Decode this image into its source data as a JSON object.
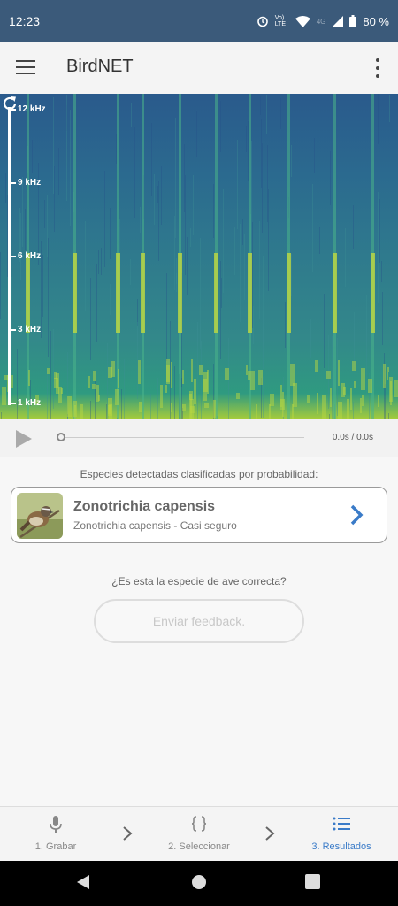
{
  "status_bar": {
    "time": "12:23",
    "network": "4G",
    "volte": "Vo) LTE",
    "battery": "80 %"
  },
  "app": {
    "title": "BirdNET"
  },
  "spectrogram": {
    "frequency_labels": [
      "12 kHz",
      "9 kHz",
      "6 kHz",
      "3 kHz",
      "1 kHz"
    ]
  },
  "player": {
    "time": "0.0s / 0.0s"
  },
  "results": {
    "heading": "Especies detectadas clasificadas por probabilidad:",
    "species": [
      {
        "name": "Zonotrichia capensis",
        "detail": "Zonotrichia capensis - Casi seguro"
      }
    ]
  },
  "feedback": {
    "question": "¿Es esta la especie de ave correcta?",
    "button": "Enviar feedback."
  },
  "bottom_nav": {
    "steps": [
      {
        "label": "1. Grabar",
        "icon": "microphone-icon"
      },
      {
        "label": "2. Seleccionar",
        "icon": "braces-icon"
      },
      {
        "label": "3. Resultados",
        "icon": "list-icon"
      }
    ],
    "active_color": "#3a7bc8"
  },
  "colors": {
    "status_bar": "#3b5a7a",
    "accent": "#3a7bc8"
  }
}
